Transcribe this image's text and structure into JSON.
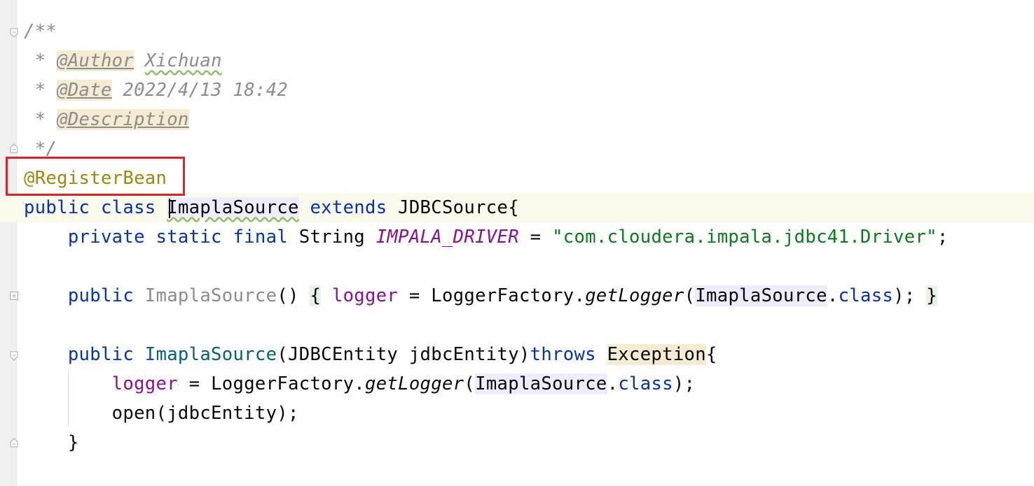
{
  "editor": {
    "lines": [
      {
        "parts": [
          {
            "t": "/**",
            "c": "cmt"
          }
        ]
      },
      {
        "parts": [
          {
            "t": " * ",
            "c": "cmt"
          },
          {
            "t": "@Author",
            "c": "tag"
          },
          {
            "t": " ",
            "c": "cmt"
          },
          {
            "t": "Xichuan",
            "c": "cmt wavy"
          }
        ]
      },
      {
        "parts": [
          {
            "t": " * ",
            "c": "cmt"
          },
          {
            "t": "@Date",
            "c": "tag"
          },
          {
            "t": " 2022/4/13 18:42",
            "c": "cmt"
          }
        ]
      },
      {
        "parts": [
          {
            "t": " * ",
            "c": "cmt"
          },
          {
            "t": "@Description",
            "c": "tag"
          }
        ]
      },
      {
        "parts": [
          {
            "t": " */",
            "c": "cmt"
          }
        ]
      },
      {
        "parts": [
          {
            "t": "@RegisterBean",
            "c": "ann"
          }
        ]
      },
      {
        "parts": [
          {
            "t": "public ",
            "c": "kw"
          },
          {
            "t": "class ",
            "c": "kw"
          },
          {
            "t": "ImaplaSource",
            "c": "cls ref wavy"
          },
          {
            "t": " extends ",
            "c": "kw"
          },
          {
            "t": "JDBCSource{",
            "c": "cls"
          }
        ]
      },
      {
        "parts": [
          {
            "t": "    private ",
            "c": "kw"
          },
          {
            "t": "static ",
            "c": "kw"
          },
          {
            "t": "final ",
            "c": "kw"
          },
          {
            "t": "String ",
            "c": "cls"
          },
          {
            "t": "IMPALA_DRIVER",
            "c": "const"
          },
          {
            "t": " = ",
            "c": "cls"
          },
          {
            "t": "\"com.cloudera.impala.jdbc41.Driver\"",
            "c": "str"
          },
          {
            "t": ";",
            "c": "cls"
          }
        ]
      },
      {
        "parts": []
      },
      {
        "parts": [
          {
            "t": "    public ",
            "c": "kw"
          },
          {
            "t": "ImaplaSource",
            "c": "gray"
          },
          {
            "t": "() ",
            "c": "cls"
          },
          {
            "t": "{",
            "c": "cls brace-hl"
          },
          {
            "t": " ",
            "c": "cls"
          },
          {
            "t": "logger",
            "c": "field"
          },
          {
            "t": " = LoggerFactory.",
            "c": "cls"
          },
          {
            "t": "getLogger",
            "c": "method"
          },
          {
            "t": "(",
            "c": "cls"
          },
          {
            "t": "ImaplaSource",
            "c": "cls ref"
          },
          {
            "t": ".",
            "c": "cls"
          },
          {
            "t": "class",
            "c": "kw"
          },
          {
            "t": "); ",
            "c": "cls"
          },
          {
            "t": "}",
            "c": "cls brace-hl"
          }
        ]
      },
      {
        "parts": []
      },
      {
        "parts": [
          {
            "t": "    public ",
            "c": "kw"
          },
          {
            "t": "ImaplaSource",
            "c": "ctor"
          },
          {
            "t": "(JDBCEntity jdbcEntity)",
            "c": "cls"
          },
          {
            "t": "throws ",
            "c": "kw"
          },
          {
            "t": "Exception",
            "c": "cls exc"
          },
          {
            "t": "{",
            "c": "cls"
          }
        ]
      },
      {
        "parts": [
          {
            "t": "        ",
            "c": "cls"
          },
          {
            "t": "logger",
            "c": "field"
          },
          {
            "t": " = LoggerFactory.",
            "c": "cls"
          },
          {
            "t": "getLogger",
            "c": "method"
          },
          {
            "t": "(",
            "c": "cls"
          },
          {
            "t": "ImaplaSource",
            "c": "cls ref"
          },
          {
            "t": ".",
            "c": "cls"
          },
          {
            "t": "class",
            "c": "kw"
          },
          {
            "t": ");",
            "c": "cls"
          }
        ]
      },
      {
        "parts": [
          {
            "t": "        open(jdbcEntity);",
            "c": "cls"
          }
        ]
      },
      {
        "parts": [
          {
            "t": "    }",
            "c": "cls"
          }
        ]
      }
    ]
  }
}
